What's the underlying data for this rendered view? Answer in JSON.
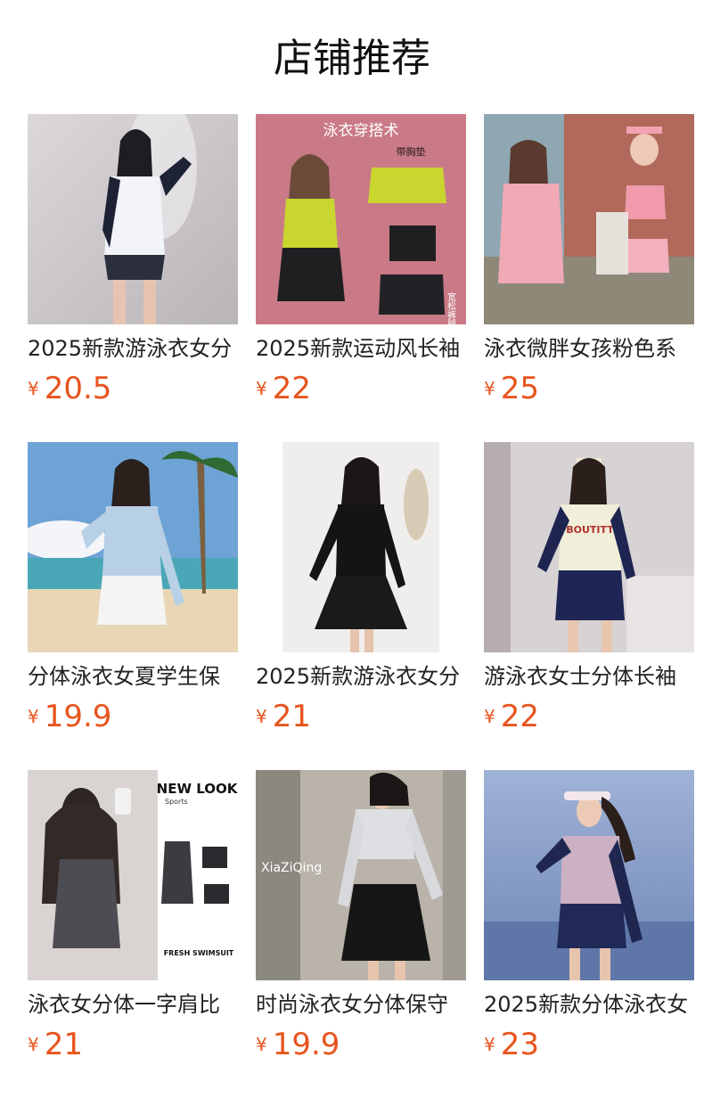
{
  "page": {
    "title": "店铺推荐"
  },
  "currency": "¥",
  "products": [
    {
      "name": "2025新款游泳衣女分",
      "price": "20.5"
    },
    {
      "name": "2025新款运动风长袖",
      "price": "22",
      "image_text": {
        "banner": "泳衣穿搭术",
        "note": "带胸垫",
        "side": "宽松裤腿"
      }
    },
    {
      "name": "泳衣微胖女孩粉色系",
      "price": "25"
    },
    {
      "name": "分体泳衣女夏学生保",
      "price": "19.9"
    },
    {
      "name": "2025新款游泳衣女分",
      "price": "21"
    },
    {
      "name": "游泳衣女士分体长袖",
      "price": "22",
      "image_text": {
        "print": "BOUTITT"
      }
    },
    {
      "name": "泳衣女分体一字肩比",
      "price": "21",
      "image_text": {
        "headline": "NEW LOOK",
        "sub": "Sports",
        "tagline": "FRESH SWIMSUIT"
      }
    },
    {
      "name": "时尚泳衣女分体保守",
      "price": "19.9",
      "image_text": {
        "brand": "XiaZiQing"
      }
    },
    {
      "name": "2025新款分体泳衣女",
      "price": "23"
    }
  ]
}
